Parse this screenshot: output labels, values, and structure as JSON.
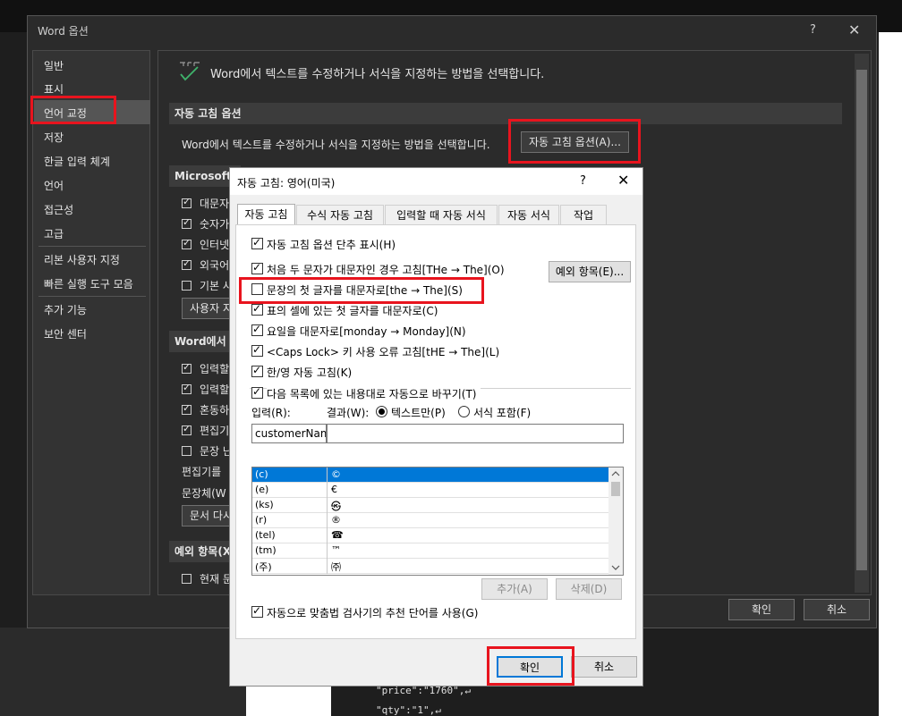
{
  "colors": {
    "highlight": "#e8141e",
    "selection": "#0078d7"
  },
  "background_code": {
    "lines": [
      "\"price\":\"1760\",↵",
      "\"qty\":\"1\",↵"
    ]
  },
  "options_window": {
    "title": "Word 옵션",
    "help": "?",
    "close": "✕",
    "nav": [
      "일반",
      "표시",
      "언어 교정",
      "저장",
      "한글 입력 체계",
      "언어",
      "접근성",
      "고급",
      "리본 사용자 지정",
      "빠른 실행 도구 모음",
      "추가 기능",
      "보안 센터"
    ],
    "nav_selected": "언어 교정",
    "header": "Word에서 텍스트를 수정하거나 서식을 지정하는 방법을 선택합니다.",
    "autocorrect_section": "자동 고침 옵션",
    "autocorrect_desc": "Word에서 텍스트를 수정하거나 서식을 지정하는 방법을 선택합니다.",
    "autocorrect_button": "자동 고침 옵션(A)...",
    "ms_section": "Microsoft",
    "ms_items": [
      {
        "label": "대문자",
        "checked": true
      },
      {
        "label": "숫자가",
        "checked": true
      },
      {
        "label": "인터넷",
        "checked": true
      },
      {
        "label": "외국어",
        "checked": true
      },
      {
        "label": "기본 사",
        "checked": false
      }
    ],
    "ms_button": "사용자 지",
    "word_section": "Word에서",
    "word_items": [
      {
        "label": "입력할",
        "checked": true
      },
      {
        "label": "입력할",
        "checked": true
      },
      {
        "label": "혼동하",
        "checked": true
      },
      {
        "label": "편집기",
        "checked": true
      },
      {
        "label": "문장 난",
        "checked": false
      }
    ],
    "editor_label": "편집기를",
    "style_label": "문장체(W",
    "doc_button": "문서 다시",
    "exceptions_section": "예외 항목(X",
    "exceptions_item": {
      "label": "현재 문",
      "checked": false
    },
    "ok": "확인",
    "cancel": "취소"
  },
  "autocorrect_dialog": {
    "title": "자동 고침: 영어(미국)",
    "help": "?",
    "close": "✕",
    "tabs": [
      "자동 고침",
      "수식 자동 고침",
      "입력할 때 자동 서식",
      "자동 서식",
      "작업"
    ],
    "active_tab": "자동 고침",
    "show_buttons": {
      "label": "자동 고침 옵션 단추 표시(H)",
      "checked": true
    },
    "options": [
      {
        "label": "처음 두 문자가 대문자인 경우 고침[THe → The](O)",
        "checked": true
      },
      {
        "label": "문장의 첫 글자를 대문자로[the → The](S)",
        "checked": false
      },
      {
        "label": "표의 셀에 있는 첫 글자를 대문자로(C)",
        "checked": true
      },
      {
        "label": "요일을 대문자로[monday → Monday](N)",
        "checked": true
      },
      {
        "label": "<Caps Lock> 키 사용 오류 고침[tHE → The](L)",
        "checked": true
      },
      {
        "label": "한/영 자동 고침(K)",
        "checked": true
      }
    ],
    "exceptions_button": "예외 항목(E)...",
    "replace_text": {
      "label": "다음 목록에 있는 내용대로 자동으로 바꾸기(T)",
      "checked": true
    },
    "input_label": "입력(R):",
    "result_label": "결과(W):",
    "radio_plain": "텍스트만(P)",
    "radio_formatted": "서식 포함(F)",
    "radio_selected": "plain",
    "input_value": "customerName",
    "result_value": "",
    "entries": [
      {
        "from": "(c)",
        "to": "©"
      },
      {
        "from": "(e)",
        "to": "€"
      },
      {
        "from": "(ks)",
        "to": "㉿"
      },
      {
        "from": "(r)",
        "to": "®"
      },
      {
        "from": "(tel)",
        "to": "☎"
      },
      {
        "from": "(tm)",
        "to": "™"
      },
      {
        "from": "(주)",
        "to": "㈜"
      }
    ],
    "selected_entry": "(c)",
    "add_button": "추가(A)",
    "delete_button": "삭제(D)",
    "spell_suggest": {
      "label": "자동으로 맞춤법 검사기의 추천 단어를 사용(G)",
      "checked": true
    },
    "ok": "확인",
    "cancel": "취소"
  }
}
